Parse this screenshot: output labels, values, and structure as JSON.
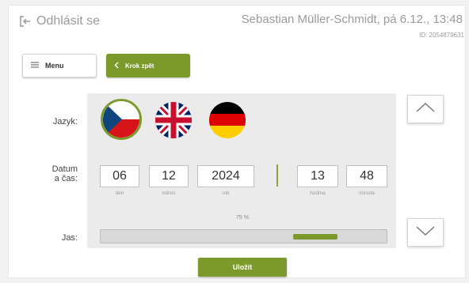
{
  "header": {
    "logout_label": "Odhlásit se",
    "user_info": "Sebastian Müller-Schmidt, pá 6.12., 13:48",
    "user_id": "ID: 2054879631"
  },
  "toolbar": {
    "menu_label": "Menu",
    "back_label": "Krok zpět"
  },
  "language": {
    "label": "Jazyk:",
    "options": [
      "cs",
      "en",
      "de"
    ],
    "selected": "cs"
  },
  "datetime": {
    "label_line1": "Datum",
    "label_line2": "a čas:",
    "day": {
      "value": "06",
      "caption": "den"
    },
    "month": {
      "value": "12",
      "caption": "měsíc"
    },
    "year": {
      "value": "2024",
      "caption": "rok"
    },
    "hour": {
      "value": "13",
      "caption": "hodina"
    },
    "minute": {
      "value": "48",
      "caption": "minuta"
    }
  },
  "brightness": {
    "label": "Jas:",
    "value_text": "75 %",
    "value": 0.75
  },
  "footer": {
    "save_label": "Uložit"
  },
  "colors": {
    "accent": "#7c9a2b"
  }
}
